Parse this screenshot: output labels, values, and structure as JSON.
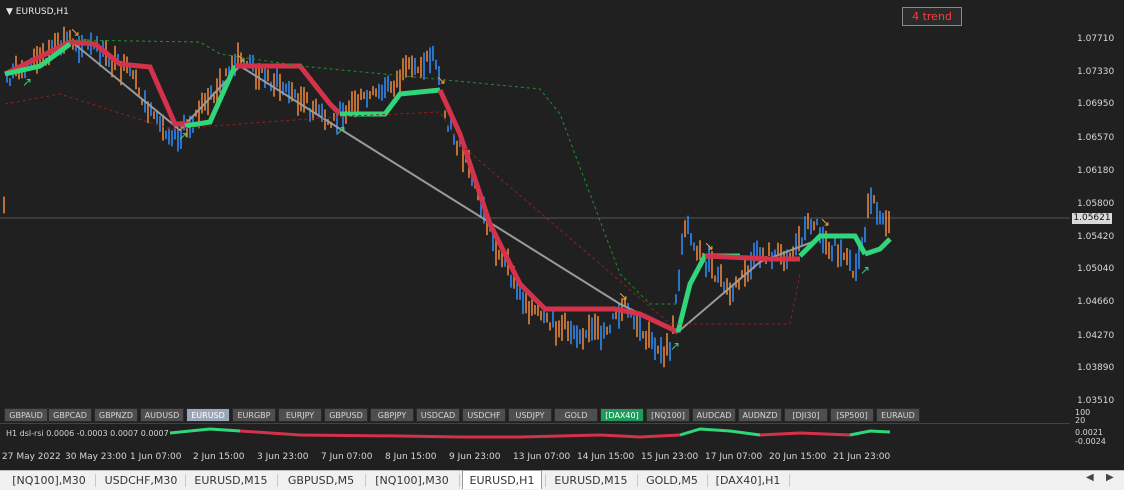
{
  "chart": {
    "title": "EURUSD,H1",
    "badge": "4 trend",
    "current_price": "1.05621",
    "price_ticks": [
      "1.07710",
      "1.07330",
      "1.06950",
      "1.06570",
      "1.06180",
      "1.05800",
      "1.05420",
      "1.05040",
      "1.04660",
      "1.04270",
      "1.03890",
      "1.03510"
    ],
    "colors": {
      "up": "#2f8fff",
      "down": "#f28a3a",
      "trend_up": "#2fd67a",
      "trend_down": "#d4324a",
      "line": "#9a9a9a"
    }
  },
  "symbols": [
    "GBPAUD",
    "GBPCAD",
    "GBPNZD",
    "AUDUSD",
    "EURUSD",
    "EURGBP",
    "EURJPY",
    "GBPUSD",
    "GBPJPY",
    "USDCAD",
    "USDCHF",
    "USDJPY",
    "GOLD",
    "[DAX40]",
    "[NQ100]",
    "AUDCAD",
    "AUDNZD",
    "[DJI30]",
    "[SP500]",
    "EURAUD"
  ],
  "sub": {
    "label": "H1 dsl-rsi 0.0006 -0.0003 0.0007 0.0007",
    "scale_top": "100",
    "scale_2": "20",
    "scale_3": "0.0021",
    "scale_bottom": "-0.0024"
  },
  "time_labels": [
    "27 May 2022",
    "30 May 23:00",
    "1 Jun 07:00",
    "2 Jun 15:00",
    "3 Jun 23:00",
    "7 Jun 07:00",
    "8 Jun 15:00",
    "9 Jun 23:00",
    "13 Jun 07:00",
    "14 Jun 15:00",
    "15 Jun 23:00",
    "17 Jun 07:00",
    "20 Jun 15:00",
    "21 Jun 23:00"
  ],
  "tabs": [
    "[NQ100],M30",
    "USDCHF,M30",
    "EURUSD,M15",
    "GBPUSD,M5",
    "[NQ100],M30",
    "EURUSD,H1",
    "EURUSD,M15",
    "GOLD,M5",
    "[DAX40],H1"
  ]
}
